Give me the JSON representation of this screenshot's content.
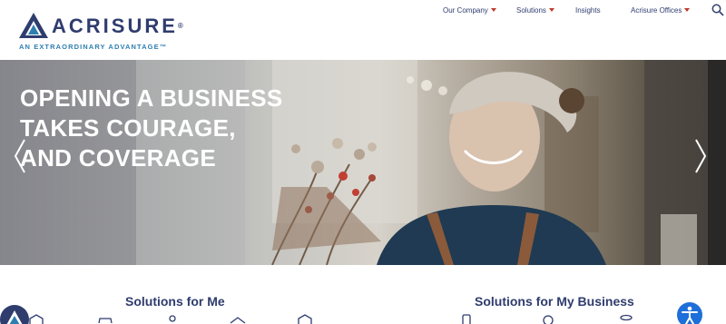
{
  "brand": {
    "name": "ACRISURE",
    "registered_mark": "®",
    "tagline": "AN EXTRAORDINARY ADVANTAGE™"
  },
  "nav": {
    "items": [
      {
        "label": "Our Company",
        "has_dropdown": true
      },
      {
        "label": "Solutions",
        "has_dropdown": true
      },
      {
        "label": "Insights",
        "has_dropdown": false
      },
      {
        "label": "Acrisure Offices",
        "has_dropdown": true
      }
    ],
    "search_icon": "search-icon"
  },
  "hero": {
    "headline_lines": [
      "OPENING A BUSINESS",
      "TAKES COURAGE,",
      "AND COVERAGE"
    ],
    "prev_icon": "chevron-left-icon",
    "next_icon": "chevron-right-icon"
  },
  "sections": {
    "personal_title": "Solutions for Me",
    "business_title": "Solutions for My Business"
  },
  "colors": {
    "brand_navy": "#2f3c6e",
    "tagline_blue": "#2e7fb0",
    "caret_red": "#c0392b",
    "accessibility_blue": "#1e6fd9"
  }
}
